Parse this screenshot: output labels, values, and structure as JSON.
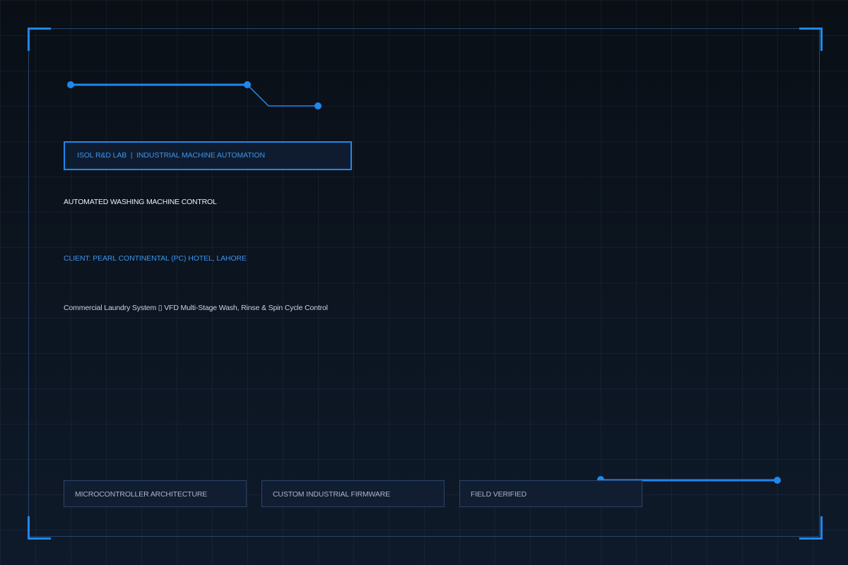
{
  "header": {
    "badge_text": "ISOL R&D LAB  |  INDUSTRIAL MACHINE AUTOMATION"
  },
  "project": {
    "title": "AUTOMATED WASHING MACHINE CONTROL",
    "client": "CLIENT: PEARL CONTINENTAL (PC) HOTEL, LAHORE",
    "subtitle": "Commercial Laundry System ▯ VFD Multi-Stage Wash, Rinse & Spin Cycle Control"
  },
  "tags": [
    {
      "label": "MICROCONTROLLER ARCHITECTURE"
    },
    {
      "label": "CUSTOM INDUSTRIAL FIRMWARE"
    },
    {
      "label": "FIELD VERIFIED"
    }
  ],
  "colors": {
    "accent": "#1e88ee",
    "background": "#0a0f16",
    "frame": "#27466e",
    "text_primary": "#e8eef6",
    "text_secondary": "#c9d3df",
    "tag_text": "#aab6c6"
  }
}
